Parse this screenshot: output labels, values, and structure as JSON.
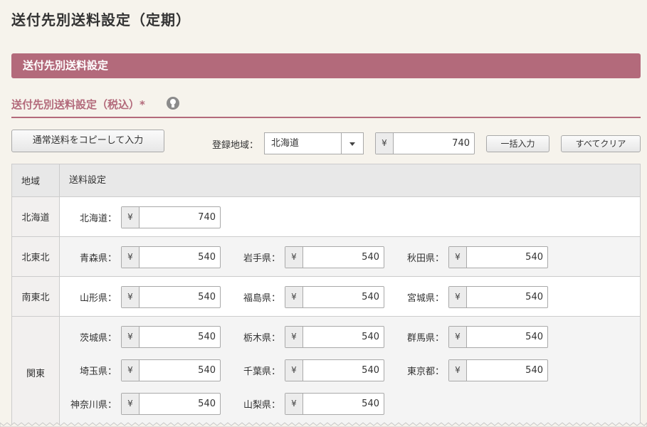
{
  "page": {
    "title": "送付先別送料設定（定期）"
  },
  "section": {
    "title": "送付先別送料設定"
  },
  "subsection": {
    "title": "送付先別送料設定（税込）*"
  },
  "toolbar": {
    "copy_label": "通常送料をコピーして入力",
    "region_label": "登録地域：",
    "region_value": "北海道",
    "currency": "¥",
    "amount": "740",
    "bulk_label": "一括入力",
    "clear_label": "すべてクリア"
  },
  "table": {
    "col_region": "地域",
    "col_settings": "送料設定",
    "rows": [
      {
        "region": "北海道",
        "prefs": [
          {
            "label": "北海道：",
            "value": "740"
          }
        ]
      },
      {
        "region": "北東北",
        "prefs": [
          {
            "label": "青森県：",
            "value": "540"
          },
          {
            "label": "岩手県：",
            "value": "540"
          },
          {
            "label": "秋田県：",
            "value": "540"
          }
        ]
      },
      {
        "region": "南東北",
        "prefs": [
          {
            "label": "山形県：",
            "value": "540"
          },
          {
            "label": "福島県：",
            "value": "540"
          },
          {
            "label": "宮城県：",
            "value": "540"
          }
        ]
      },
      {
        "region": "関東",
        "prefs": [
          {
            "label": "茨城県：",
            "value": "540"
          },
          {
            "label": "栃木県：",
            "value": "540"
          },
          {
            "label": "群馬県：",
            "value": "540"
          },
          {
            "label": "埼玉県：",
            "value": "540"
          },
          {
            "label": "千葉県：",
            "value": "540"
          },
          {
            "label": "東京都：",
            "value": "540"
          },
          {
            "label": "神奈川県：",
            "value": "540"
          },
          {
            "label": "山梨県：",
            "value": "540"
          }
        ]
      }
    ]
  }
}
